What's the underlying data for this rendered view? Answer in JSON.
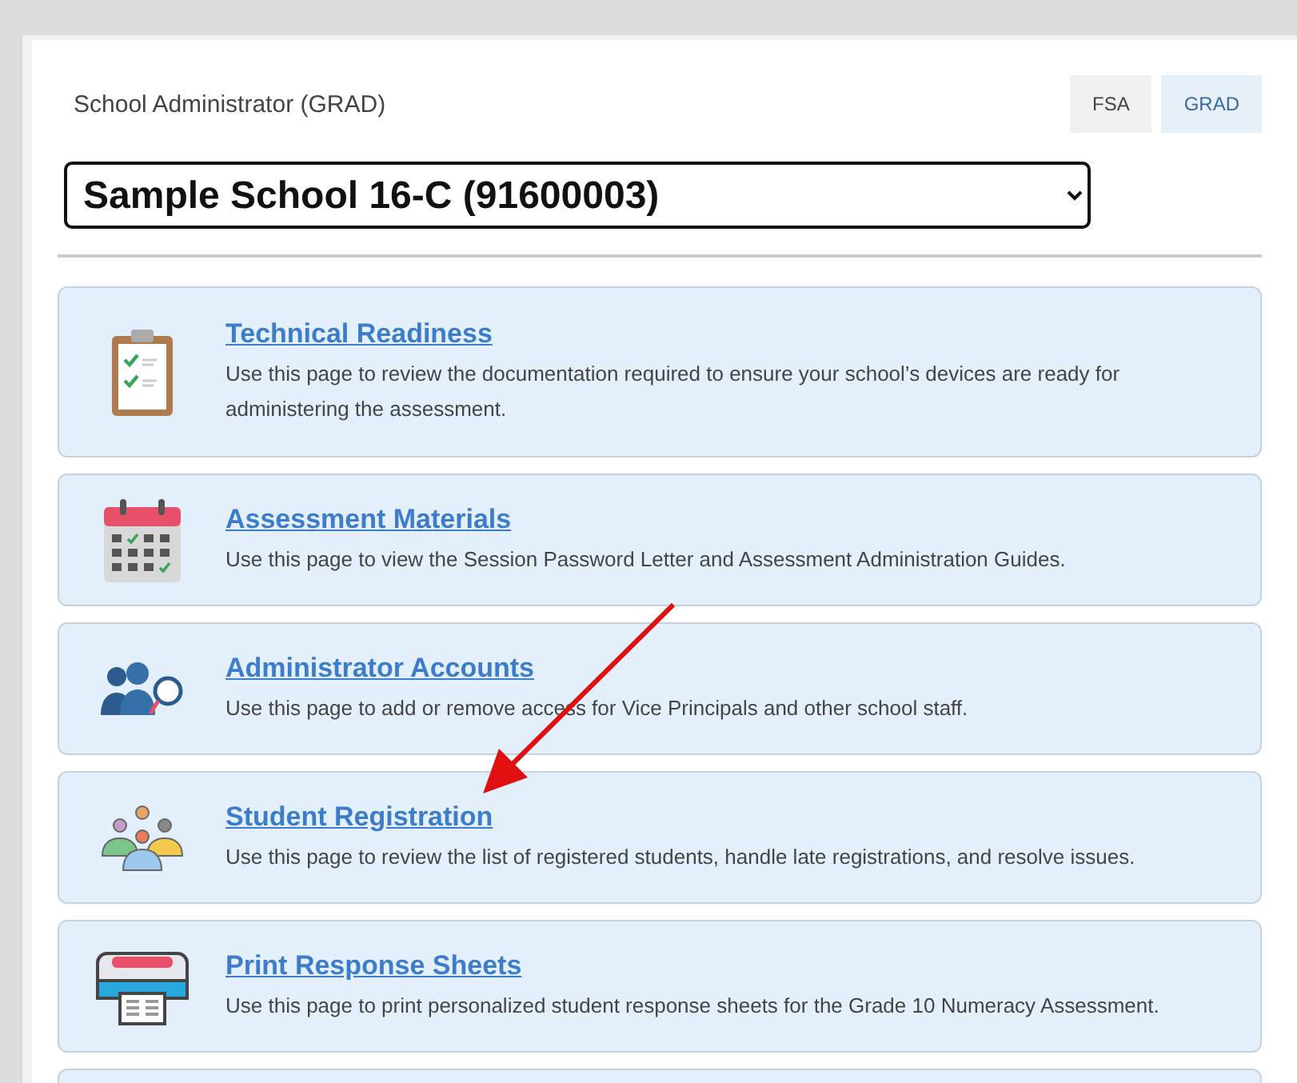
{
  "header": {
    "title": "School Administrator (GRAD)"
  },
  "tabs": [
    {
      "label": "FSA",
      "selected": false
    },
    {
      "label": "GRAD",
      "selected": true
    }
  ],
  "school_select": {
    "value": "Sample School 16-C (91600003)"
  },
  "cards": [
    {
      "kind": "clipboard",
      "title": "Technical Readiness",
      "description": "Use this page to review the documentation required to ensure your school’s devices are ready for administering the assessment."
    },
    {
      "kind": "calendar",
      "title": "Assessment Materials",
      "description": "Use this page to view the Session Password Letter and Assessment Administration Guides."
    },
    {
      "kind": "accounts",
      "title": "Administrator Accounts",
      "description": "Use this page to add or remove access for Vice Principals and other school staff."
    },
    {
      "kind": "students",
      "title": "Student Registration",
      "description": "Use this page to review the list of registered students, handle late registrations, and resolve issues."
    },
    {
      "kind": "printer",
      "title": "Print Response Sheets",
      "description": "Use this page to print personalized student response sheets for the Grade 10 Numeracy Assessment."
    }
  ]
}
